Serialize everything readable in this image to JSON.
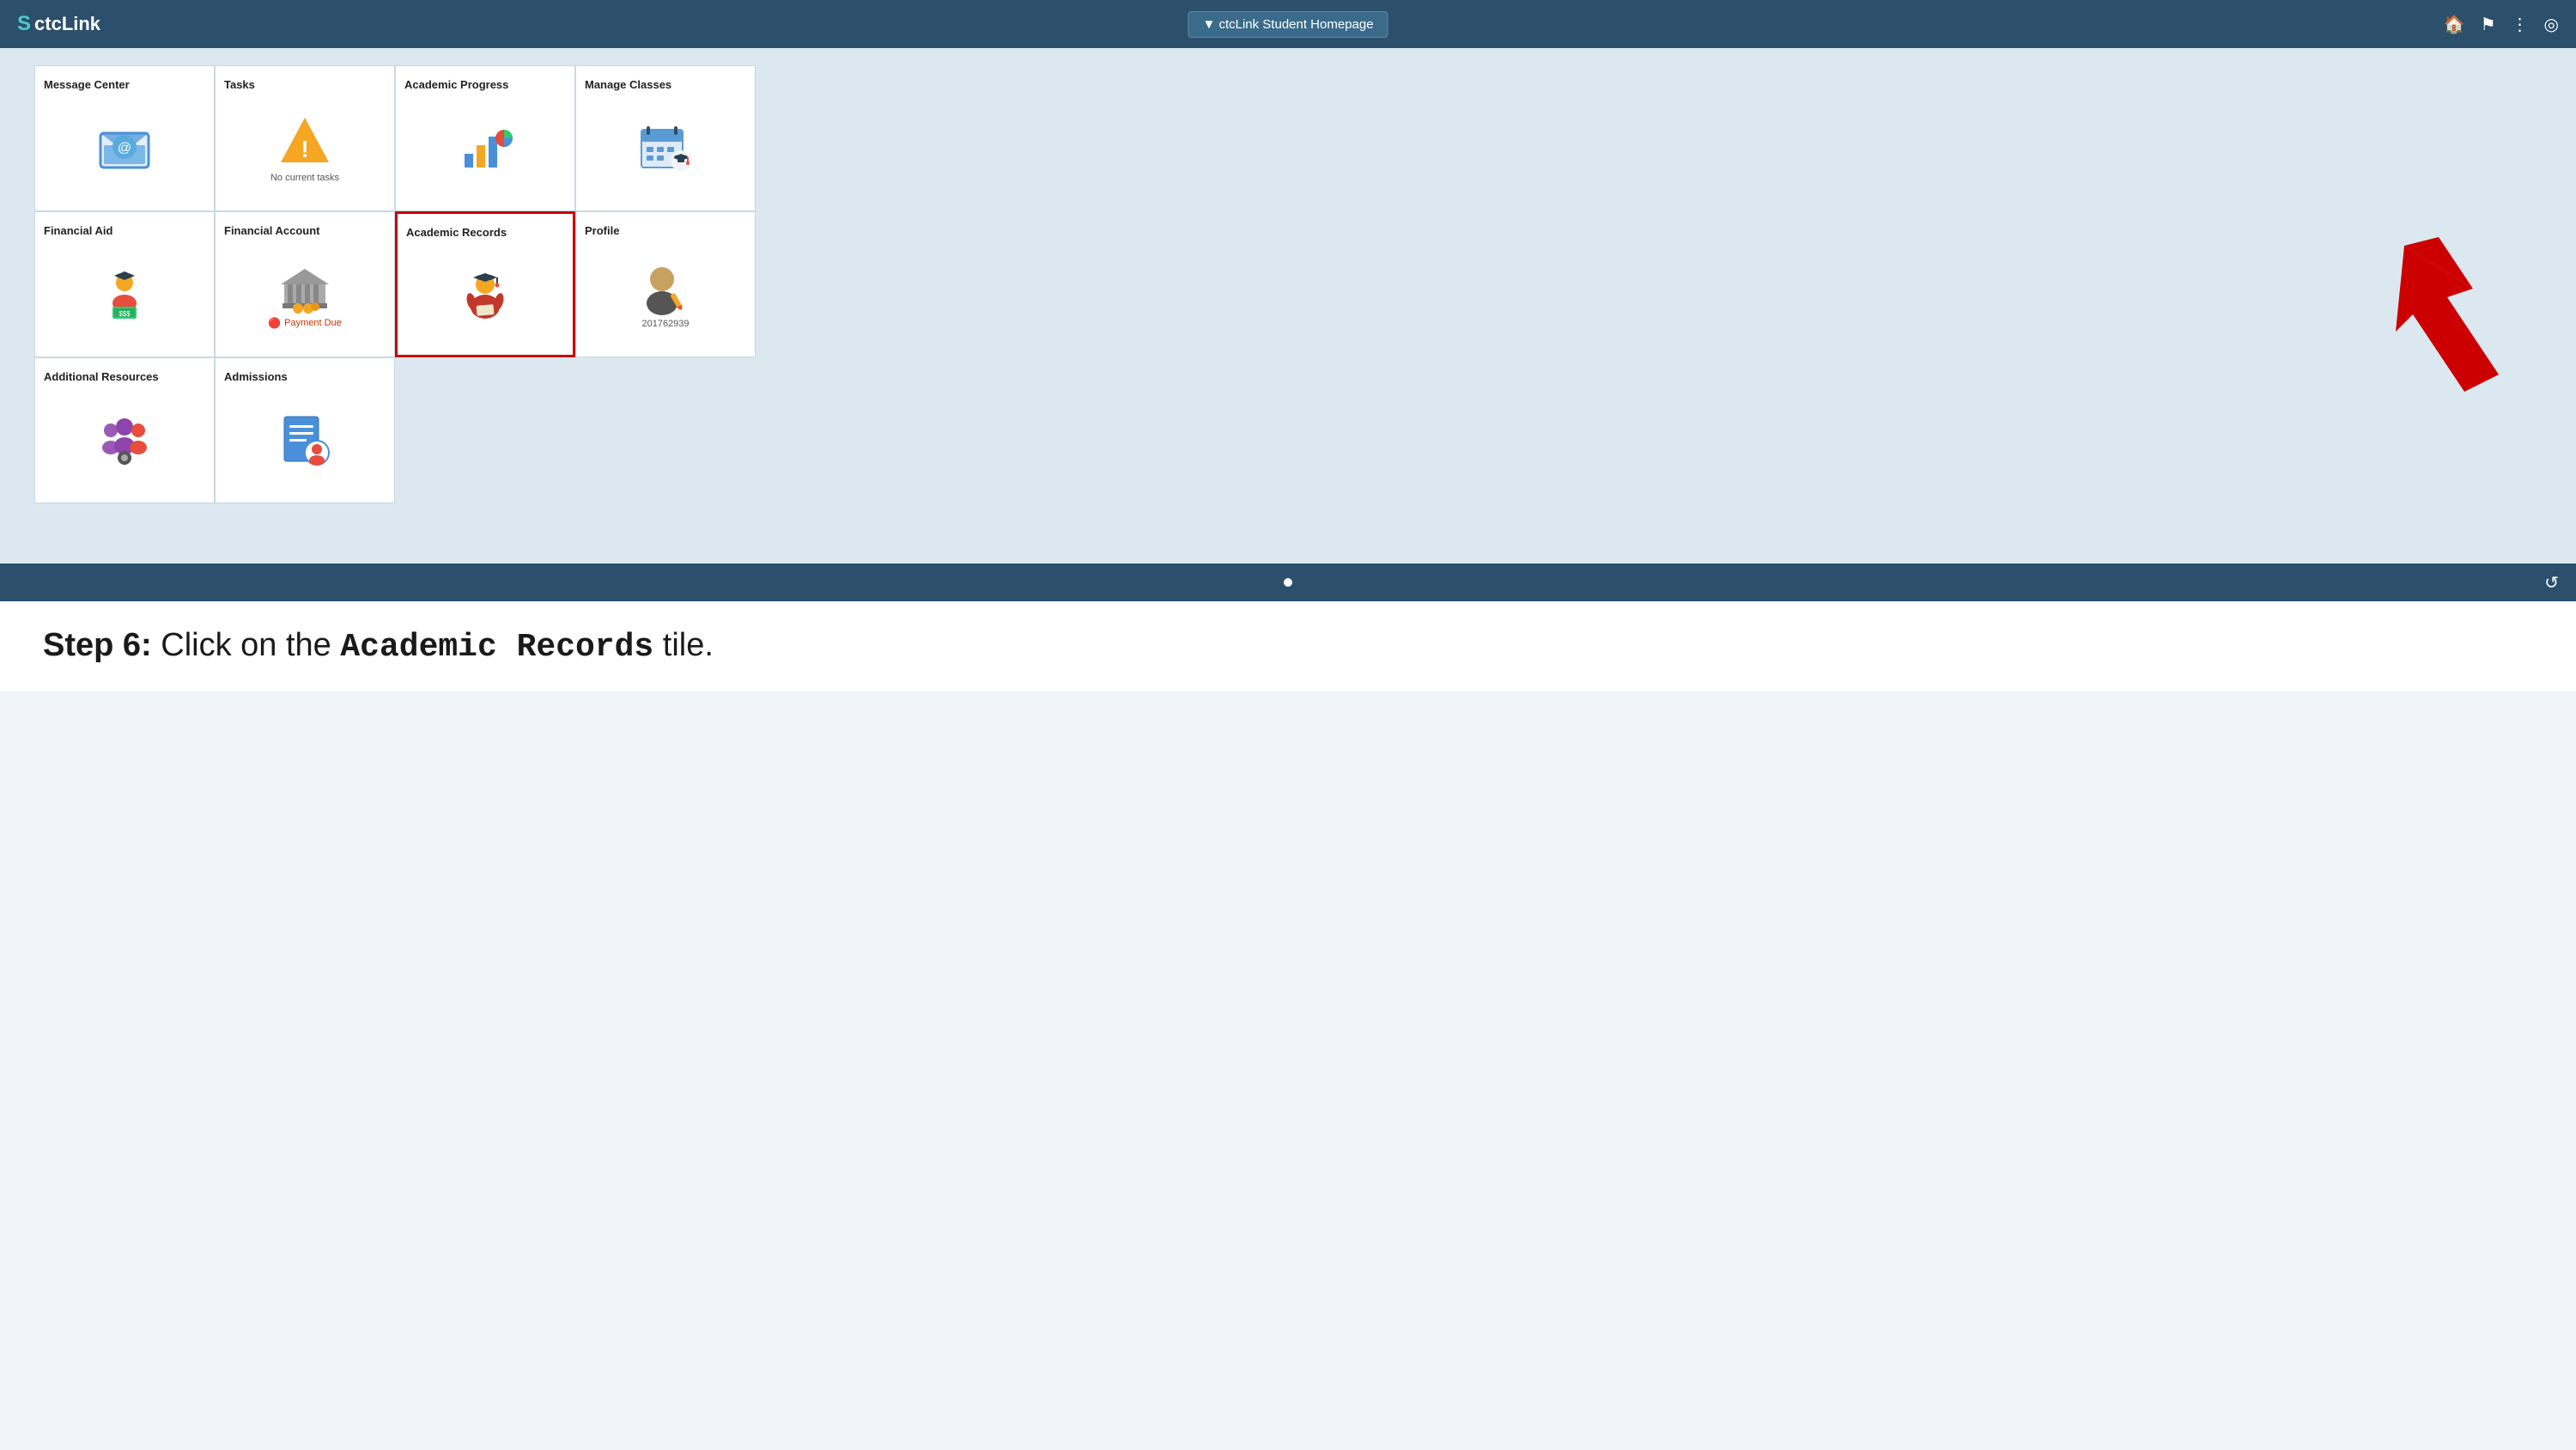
{
  "nav": {
    "logo": "CtcLink",
    "logo_symbol": "S",
    "dropdown_label": "▼ ctcLink Student Homepage",
    "icons": [
      "🏠",
      "⚑",
      "⋮",
      "◎"
    ]
  },
  "tiles": {
    "row1": [
      {
        "id": "message-center",
        "title": "Message Center",
        "subtitle": "",
        "badge": "",
        "icon_type": "message"
      },
      {
        "id": "tasks",
        "title": "Tasks",
        "subtitle": "No current tasks",
        "badge": "",
        "icon_type": "tasks"
      },
      {
        "id": "academic-progress",
        "title": "Academic Progress",
        "subtitle": "",
        "badge": "",
        "icon_type": "academic-progress"
      },
      {
        "id": "manage-classes",
        "title": "Manage Classes",
        "subtitle": "",
        "badge": "",
        "icon_type": "manage-classes"
      }
    ],
    "row2": [
      {
        "id": "financial-aid",
        "title": "Financial Aid",
        "subtitle": "",
        "badge": "",
        "icon_type": "financial-aid"
      },
      {
        "id": "financial-account",
        "title": "Financial Account",
        "subtitle": "",
        "badge": "Payment Due",
        "icon_type": "financial-account"
      },
      {
        "id": "academic-records",
        "title": "Academic Records",
        "subtitle": "",
        "badge": "",
        "icon_type": "academic-records",
        "highlighted": true
      },
      {
        "id": "profile",
        "title": "Profile",
        "subtitle": "201762939",
        "badge": "",
        "icon_type": "profile"
      }
    ],
    "row3": [
      {
        "id": "additional-resources",
        "title": "Additional Resources",
        "subtitle": "",
        "badge": "",
        "icon_type": "additional"
      },
      {
        "id": "admissions",
        "title": "Admissions",
        "subtitle": "",
        "badge": "",
        "icon_type": "admissions"
      }
    ]
  },
  "instruction": {
    "step_label": "Step 6:",
    "step_text": " Click on the ",
    "highlight": "Academic Records",
    "step_end": " tile."
  },
  "bottom": {
    "refresh_icon": "↺"
  }
}
